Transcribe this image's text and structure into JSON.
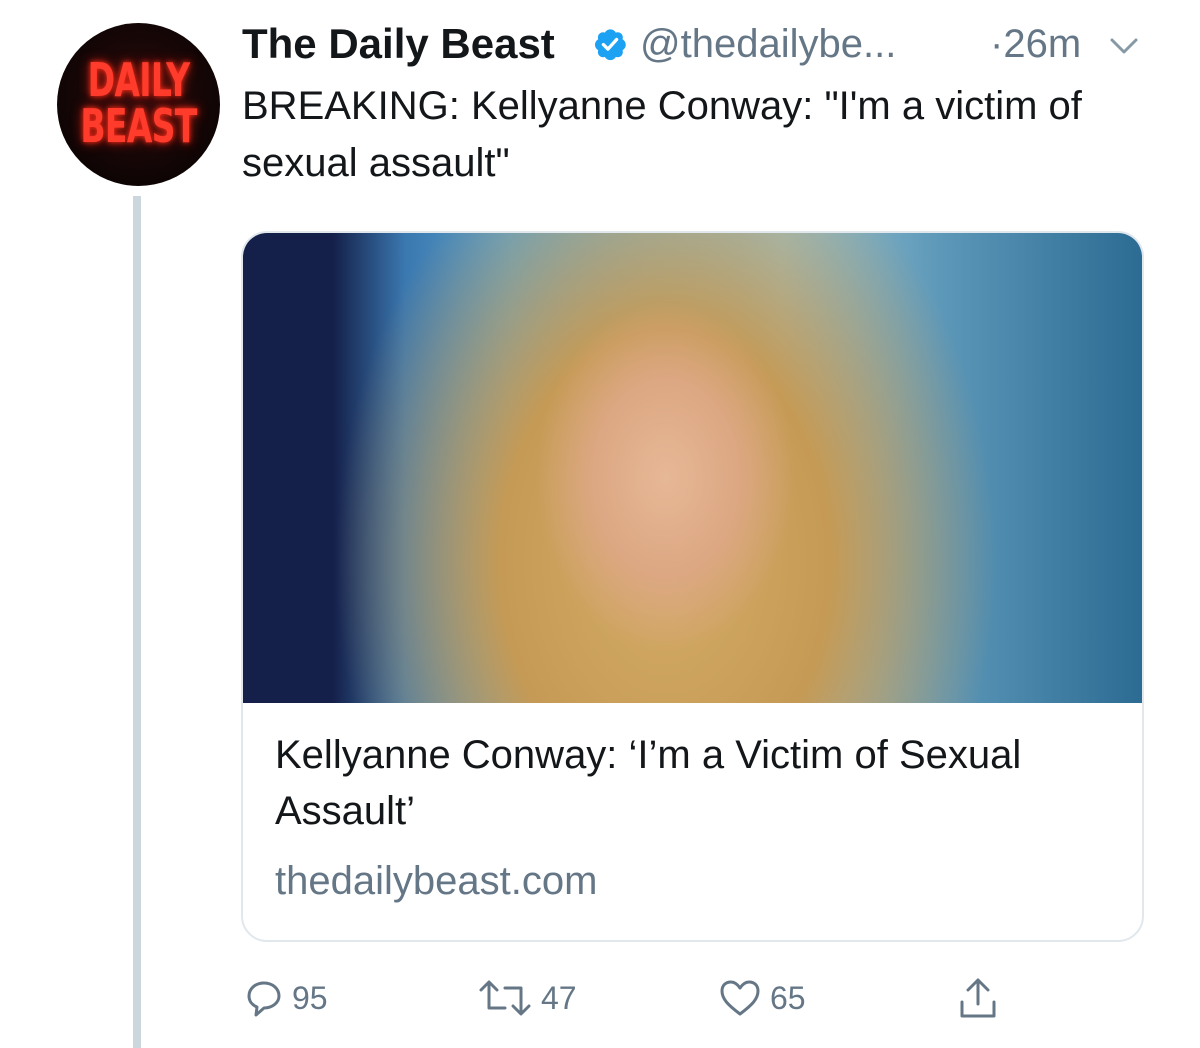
{
  "account": {
    "avatar_text_line1": "DAILY",
    "avatar_text_line2": "BEAST",
    "name": "The Daily Beast",
    "verified_icon": "verified-badge-icon",
    "handle": "@thedailybe...",
    "time": "·26m"
  },
  "tweet": {
    "text": "BREAKING: Kellyanne Conway: \"I'm a victim of sexual assault\""
  },
  "card": {
    "title": "Kellyanne Conway: ‘I’m a Victim of Sexual Assault’",
    "domain": "thedailybeast.com"
  },
  "actions": {
    "reply_count": "95",
    "retweet_count": "47",
    "like_count": "65"
  },
  "colors": {
    "secondary_text": "#657786",
    "verified_blue": "#1da1f2",
    "thread_line": "#ccd6dd",
    "card_border": "#e1e8ed"
  }
}
